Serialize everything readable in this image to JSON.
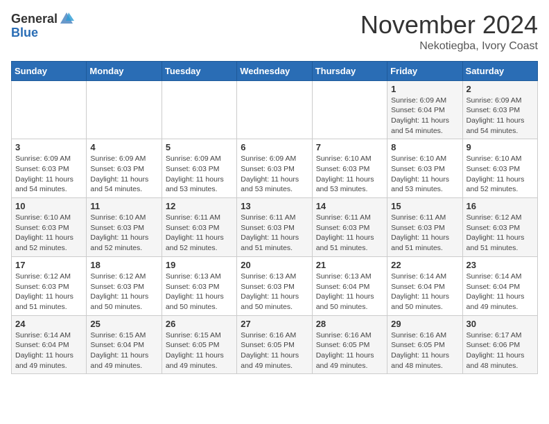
{
  "logo": {
    "general": "General",
    "blue": "Blue"
  },
  "title": "November 2024",
  "location": "Nekotiegba, Ivory Coast",
  "days_of_week": [
    "Sunday",
    "Monday",
    "Tuesday",
    "Wednesday",
    "Thursday",
    "Friday",
    "Saturday"
  ],
  "weeks": [
    [
      {
        "day": "",
        "info": ""
      },
      {
        "day": "",
        "info": ""
      },
      {
        "day": "",
        "info": ""
      },
      {
        "day": "",
        "info": ""
      },
      {
        "day": "",
        "info": ""
      },
      {
        "day": "1",
        "info": "Sunrise: 6:09 AM\nSunset: 6:04 PM\nDaylight: 11 hours and 54 minutes."
      },
      {
        "day": "2",
        "info": "Sunrise: 6:09 AM\nSunset: 6:03 PM\nDaylight: 11 hours and 54 minutes."
      }
    ],
    [
      {
        "day": "3",
        "info": "Sunrise: 6:09 AM\nSunset: 6:03 PM\nDaylight: 11 hours and 54 minutes."
      },
      {
        "day": "4",
        "info": "Sunrise: 6:09 AM\nSunset: 6:03 PM\nDaylight: 11 hours and 54 minutes."
      },
      {
        "day": "5",
        "info": "Sunrise: 6:09 AM\nSunset: 6:03 PM\nDaylight: 11 hours and 53 minutes."
      },
      {
        "day": "6",
        "info": "Sunrise: 6:09 AM\nSunset: 6:03 PM\nDaylight: 11 hours and 53 minutes."
      },
      {
        "day": "7",
        "info": "Sunrise: 6:10 AM\nSunset: 6:03 PM\nDaylight: 11 hours and 53 minutes."
      },
      {
        "day": "8",
        "info": "Sunrise: 6:10 AM\nSunset: 6:03 PM\nDaylight: 11 hours and 53 minutes."
      },
      {
        "day": "9",
        "info": "Sunrise: 6:10 AM\nSunset: 6:03 PM\nDaylight: 11 hours and 52 minutes."
      }
    ],
    [
      {
        "day": "10",
        "info": "Sunrise: 6:10 AM\nSunset: 6:03 PM\nDaylight: 11 hours and 52 minutes."
      },
      {
        "day": "11",
        "info": "Sunrise: 6:10 AM\nSunset: 6:03 PM\nDaylight: 11 hours and 52 minutes."
      },
      {
        "day": "12",
        "info": "Sunrise: 6:11 AM\nSunset: 6:03 PM\nDaylight: 11 hours and 52 minutes."
      },
      {
        "day": "13",
        "info": "Sunrise: 6:11 AM\nSunset: 6:03 PM\nDaylight: 11 hours and 51 minutes."
      },
      {
        "day": "14",
        "info": "Sunrise: 6:11 AM\nSunset: 6:03 PM\nDaylight: 11 hours and 51 minutes."
      },
      {
        "day": "15",
        "info": "Sunrise: 6:11 AM\nSunset: 6:03 PM\nDaylight: 11 hours and 51 minutes."
      },
      {
        "day": "16",
        "info": "Sunrise: 6:12 AM\nSunset: 6:03 PM\nDaylight: 11 hours and 51 minutes."
      }
    ],
    [
      {
        "day": "17",
        "info": "Sunrise: 6:12 AM\nSunset: 6:03 PM\nDaylight: 11 hours and 51 minutes."
      },
      {
        "day": "18",
        "info": "Sunrise: 6:12 AM\nSunset: 6:03 PM\nDaylight: 11 hours and 50 minutes."
      },
      {
        "day": "19",
        "info": "Sunrise: 6:13 AM\nSunset: 6:03 PM\nDaylight: 11 hours and 50 minutes."
      },
      {
        "day": "20",
        "info": "Sunrise: 6:13 AM\nSunset: 6:03 PM\nDaylight: 11 hours and 50 minutes."
      },
      {
        "day": "21",
        "info": "Sunrise: 6:13 AM\nSunset: 6:04 PM\nDaylight: 11 hours and 50 minutes."
      },
      {
        "day": "22",
        "info": "Sunrise: 6:14 AM\nSunset: 6:04 PM\nDaylight: 11 hours and 50 minutes."
      },
      {
        "day": "23",
        "info": "Sunrise: 6:14 AM\nSunset: 6:04 PM\nDaylight: 11 hours and 49 minutes."
      }
    ],
    [
      {
        "day": "24",
        "info": "Sunrise: 6:14 AM\nSunset: 6:04 PM\nDaylight: 11 hours and 49 minutes."
      },
      {
        "day": "25",
        "info": "Sunrise: 6:15 AM\nSunset: 6:04 PM\nDaylight: 11 hours and 49 minutes."
      },
      {
        "day": "26",
        "info": "Sunrise: 6:15 AM\nSunset: 6:05 PM\nDaylight: 11 hours and 49 minutes."
      },
      {
        "day": "27",
        "info": "Sunrise: 6:16 AM\nSunset: 6:05 PM\nDaylight: 11 hours and 49 minutes."
      },
      {
        "day": "28",
        "info": "Sunrise: 6:16 AM\nSunset: 6:05 PM\nDaylight: 11 hours and 49 minutes."
      },
      {
        "day": "29",
        "info": "Sunrise: 6:16 AM\nSunset: 6:05 PM\nDaylight: 11 hours and 48 minutes."
      },
      {
        "day": "30",
        "info": "Sunrise: 6:17 AM\nSunset: 6:06 PM\nDaylight: 11 hours and 48 minutes."
      }
    ]
  ]
}
